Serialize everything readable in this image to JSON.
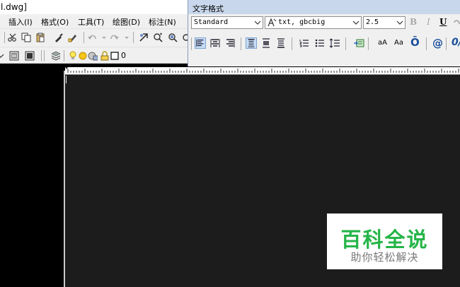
{
  "cad_window": {
    "title": "l.dwg]",
    "menu": [
      "插入(I)",
      "格式(O)",
      "工具(T)",
      "绘图(D)",
      "标注(N)"
    ],
    "layer_value": "0"
  },
  "text_format": {
    "title": "文字格式",
    "style": "Standard",
    "font": "txt, gbcbig",
    "height": "2.5",
    "bold_label": "B",
    "italic_label": "I",
    "underline_label": "U",
    "case_upper_label": "aA",
    "case_lower_label": "Aa",
    "overline_label": "Ō",
    "symbol_label": "@",
    "oblique_label": "0/"
  },
  "watermark": {
    "brand": "百科全说",
    "slogan": "助你轻松解决"
  },
  "colors": {
    "editor_bg": "#1c1c1c",
    "panel_title_bg": "#c9d7ec",
    "brand_green": "#25b548"
  }
}
